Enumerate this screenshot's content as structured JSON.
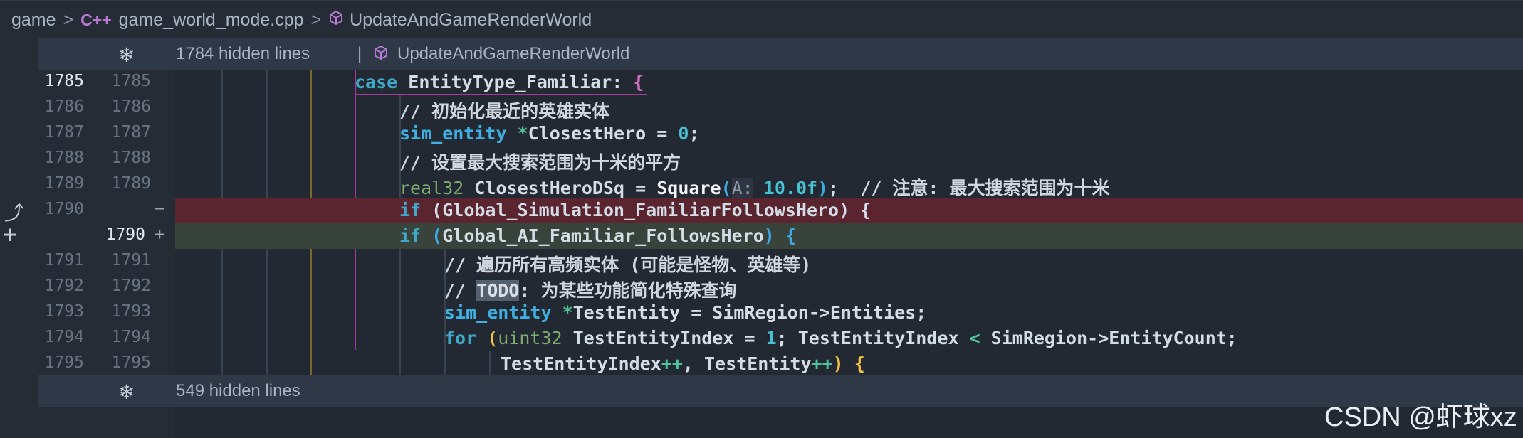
{
  "breadcrumb": {
    "folder": "game",
    "sep": ">",
    "file_icon": "C++",
    "file": "game_world_mode.cpp",
    "symbol": "UpdateAndGameRenderWorld"
  },
  "fold_top": {
    "hidden": "1784 hidden lines",
    "sep": "|",
    "symbol": "UpdateAndGameRenderWorld"
  },
  "fold_bottom": {
    "hidden": "549 hidden lines"
  },
  "lines": [
    {
      "old": "1785",
      "new": "1785"
    },
    {
      "old": "1786",
      "new": "1786"
    },
    {
      "old": "1787",
      "new": "1787"
    },
    {
      "old": "1788",
      "new": "1788"
    },
    {
      "old": "1789",
      "new": "1789"
    },
    {
      "old": "1790",
      "new": "",
      "marker": "−"
    },
    {
      "old": "",
      "new": "1790",
      "marker": "+"
    },
    {
      "old": "1791",
      "new": "1791"
    },
    {
      "old": "1792",
      "new": "1792"
    },
    {
      "old": "1793",
      "new": "1793"
    },
    {
      "old": "1794",
      "new": "1794"
    },
    {
      "old": "1795",
      "new": "1795"
    }
  ],
  "code": {
    "l1_kw": "case",
    "l1_rest": " EntityType_Familiar: ",
    "l1_brace": "{",
    "l2": "// 初始化最近的英雄实体",
    "l3_type": "sim_entity",
    "l3_op": " *",
    "l3_rest": "ClosestHero = ",
    "l3_num": "0",
    "l3_end": ";",
    "l4": "// 设置最大搜索范围为十米的平方",
    "l5_type": "real32",
    "l5_rest": " ClosestHeroDSq = ",
    "l5_fn": "Square",
    "l5_open": "(",
    "l5_hint": "A:",
    "l5_num": " 10.0f",
    "l5_close": ")",
    "l5_semi": ";  ",
    "l5_cmt": "// 注意: 最大搜索范围为十米",
    "l6_kw": "if",
    "l6_rest": " (Global_Simulation_FamiliarFollowsHero) {",
    "l7_kw": "if",
    "l7_open": " (",
    "l7_rest": "Global_AI_Familiar_FollowsHero",
    "l7_close": ")",
    "l7_brace": " {",
    "l8": "// 遍历所有高频实体 (可能是怪物、英雄等)",
    "l9_pre": "// ",
    "l9_todo": "TODO",
    "l9_rest": ": 为某些功能简化特殊查询",
    "l10_type": "sim_entity",
    "l10_op": " *",
    "l10_rest": "TestEntity = SimRegion->Entities;",
    "l11_kw": "for",
    "l11_open": " (",
    "l11_type": "uint32",
    "l11_rest1": " TestEntityIndex = ",
    "l11_num": "1",
    "l11_rest2": "; TestEntityIndex ",
    "l11_lt": "<",
    "l11_rest3": " SimRegion->EntityCount;",
    "l12_a": "TestEntityIndex",
    "l12_pp1": "++",
    "l12_b": ", TestEntity",
    "l12_pp2": "++",
    "l12_close": ")",
    "l12_brace": " {"
  },
  "icons": {
    "fold": "expand-fold-icon",
    "revert": "revert-icon",
    "add": "add-icon",
    "symbol": "cube-symbol-icon"
  },
  "watermark": "CSDN @虾球xz"
}
